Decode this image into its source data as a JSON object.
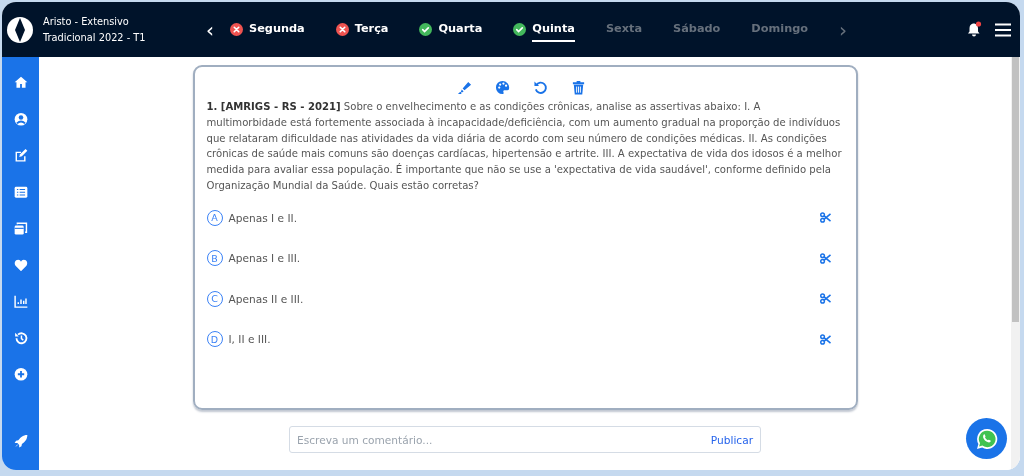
{
  "app": {
    "title_line_1": "Aristo - Extensivo",
    "title_line_2": "Tradicional 2022 - T1"
  },
  "days_nav": {
    "prev": "‹",
    "next": "›"
  },
  "days": [
    {
      "label": "Segunda",
      "kind": "wrong",
      "selected": false,
      "disabled": false
    },
    {
      "label": "Terça",
      "kind": "wrong",
      "selected": false,
      "disabled": false
    },
    {
      "label": "Quarta",
      "kind": "correct",
      "selected": false,
      "disabled": false
    },
    {
      "label": "Quinta",
      "kind": "correct",
      "selected": true,
      "disabled": false
    },
    {
      "label": "Sexta",
      "kind": "pending",
      "selected": false,
      "disabled": true
    },
    {
      "label": "Sábado",
      "kind": "pending",
      "selected": false,
      "disabled": true
    },
    {
      "label": "Domingo",
      "kind": "pending",
      "selected": false,
      "disabled": true
    }
  ],
  "notifications": {
    "unread": true
  },
  "sidebar": {
    "items": [
      {
        "kind": "home"
      },
      {
        "kind": "user"
      },
      {
        "kind": "edit"
      },
      {
        "kind": "list"
      },
      {
        "kind": "cards"
      },
      {
        "kind": "heart"
      },
      {
        "kind": "chart"
      },
      {
        "kind": "history"
      },
      {
        "kind": "plus"
      },
      {
        "kind": "rocket"
      }
    ]
  },
  "question": {
    "text": "**1. [AMRIGS - RS - 2021]** Sobre o envelhecimento e as condições crônicas, analise as assertivas abaixo: I. A multimorbidade está fortemente associada à incapacidade/deficiência, com um aumento gradual na proporção de indivíduos que relataram dificuldade nas atividades da vida diária de acordo com seu número de condições médicas. II. As condições crônicas de saúde mais comuns são doenças cardíacas, hipertensão e artrite. III. A expectativa de vida dos idosos é a melhor medida para avaliar essa população. É importante que não se use a 'expectativa de vida saudável', conforme definido pela Organização Mundial da Saúde. Quais estão corretas?",
    "options": [
      {
        "letter": "A",
        "text": "Apenas I e II.",
        "selected": false
      },
      {
        "letter": "B",
        "text": "Apenas I e III.",
        "selected": false
      },
      {
        "letter": "C",
        "text": "Apenas II e III.",
        "selected": false
      },
      {
        "letter": "D",
        "text": "I, II e III.",
        "selected": false
      }
    ]
  },
  "comment": {
    "placeholder": "Escreva um comentário...",
    "button": "Publicar"
  }
}
